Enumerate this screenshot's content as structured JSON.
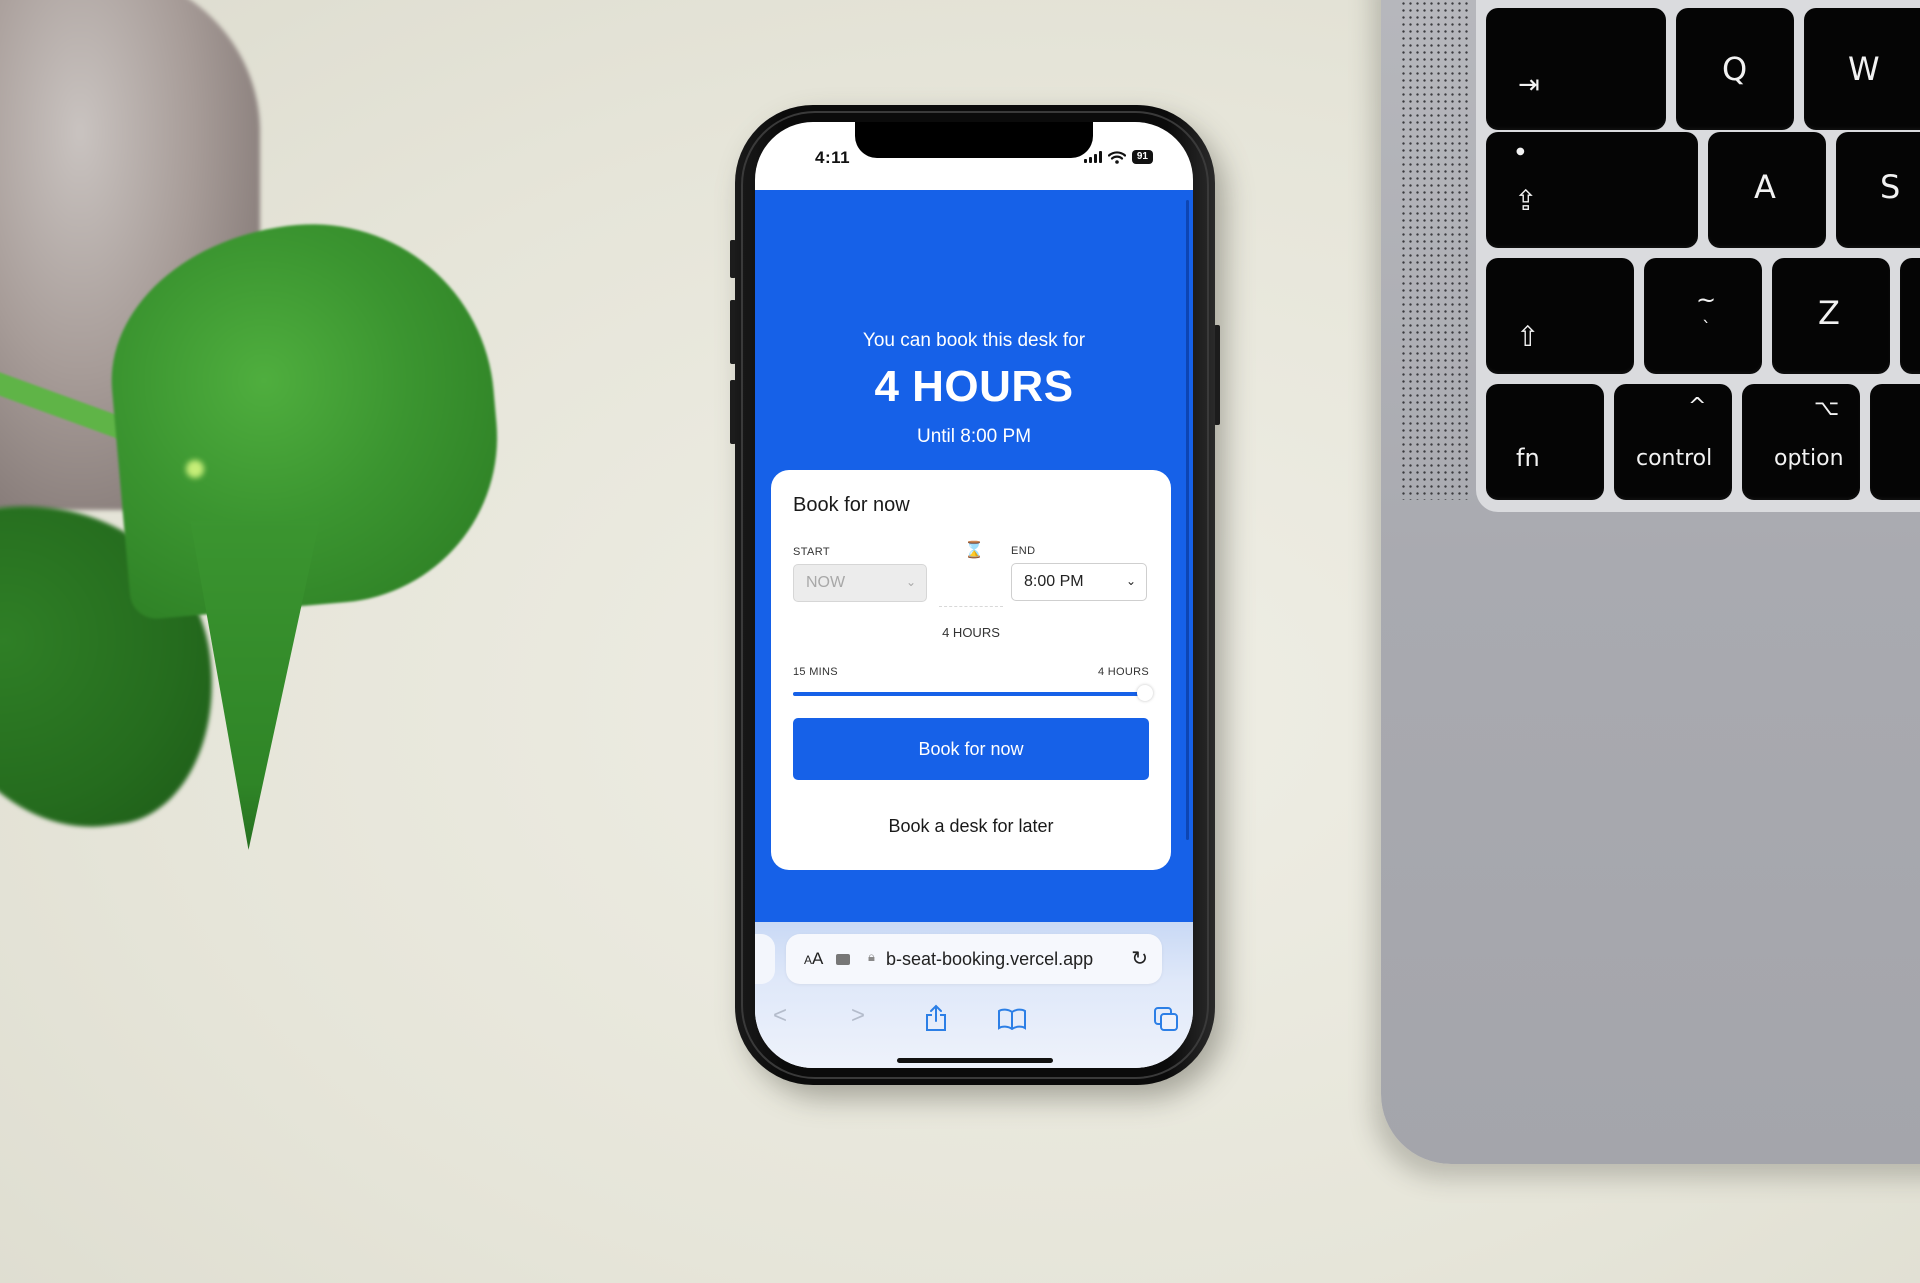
{
  "status_bar": {
    "time": "4:11",
    "battery": "91"
  },
  "hero": {
    "subtitle": "You can book this desk for",
    "duration": "4 HOURS",
    "until": "Until 8:00 PM"
  },
  "booking_card": {
    "title": "Book for now",
    "start": {
      "label": "START",
      "value": "NOW",
      "disabled": true
    },
    "end": {
      "label": "END",
      "value": "8:00 PM"
    },
    "duration_label": "4 HOURS",
    "slider": {
      "min_label": "15 MINS",
      "max_label": "4 HOURS",
      "value_fraction": 1.0
    },
    "primary_button": "Book for now",
    "secondary_button": "Book a desk for later"
  },
  "browser": {
    "text_size_label": "AA",
    "url": "b-seat-booking.vercel.app"
  },
  "keyboard": {
    "keys": [
      "⇥",
      "Q",
      "W",
      "⇪",
      "A",
      "S",
      "⇧",
      "~",
      "Z",
      "fn",
      "control",
      "option"
    ]
  },
  "colors": {
    "primary": "#1661e8",
    "background": "#e9e8dd"
  }
}
